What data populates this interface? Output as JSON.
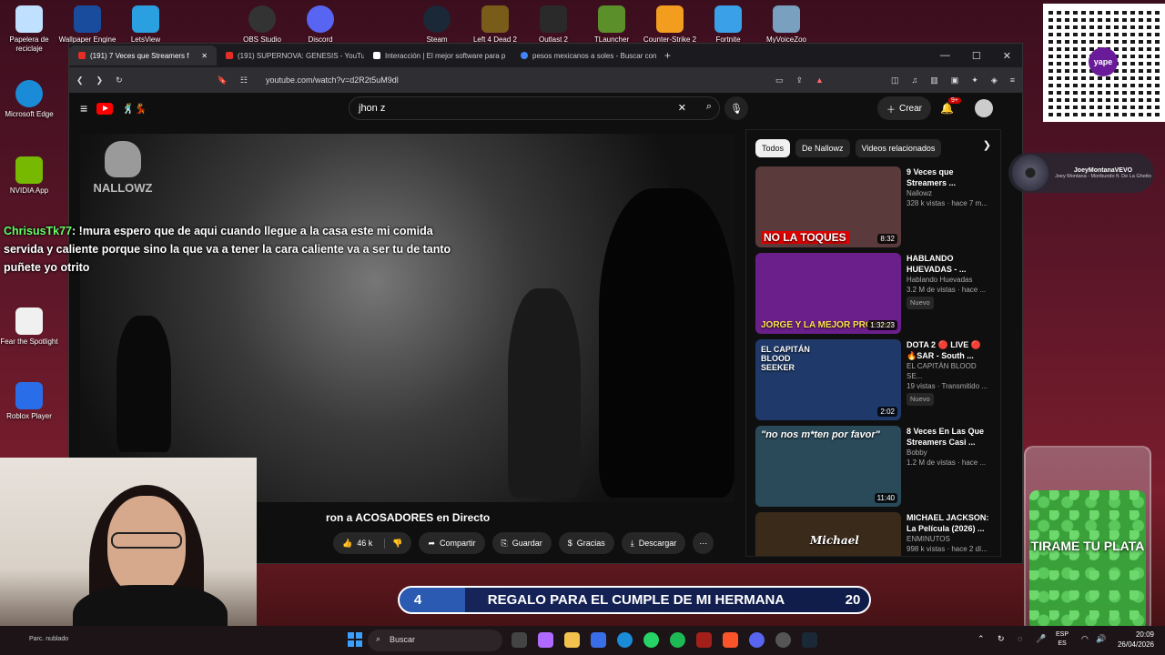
{
  "desktop_icons": [
    {
      "label": "Papelera de reciclaje",
      "color": "#bfe0ff"
    },
    {
      "label": "Wallpaper Engine",
      "color": "#1a4c9e"
    },
    {
      "label": "LetsView",
      "color": "#2aa0e0"
    },
    {
      "label": "OBS Studio",
      "color": "#333333"
    },
    {
      "label": "Discord",
      "color": "#5865f2"
    },
    {
      "label": "Steam",
      "color": "#1b2838"
    },
    {
      "label": "Left 4 Dead 2",
      "color": "#7a5c1a"
    },
    {
      "label": "Outlast 2",
      "color": "#2a2a2a"
    },
    {
      "label": "TLauncher",
      "color": "#5a8f2a"
    },
    {
      "label": "Counter-Strike 2",
      "color": "#f29d1e"
    },
    {
      "label": "Fortnite",
      "color": "#3aa0e8"
    },
    {
      "label": "MyVoiceZoo",
      "color": "#7aa0c0"
    },
    {
      "label": "Microsoft Edge",
      "color": "#1a8bd6"
    },
    {
      "label": "NVIDIA App",
      "color": "#76b900"
    },
    {
      "label": "Fear the Spotlight",
      "color": "#f0f0f0"
    },
    {
      "label": "Roblox Player",
      "color": "#2a6de8"
    }
  ],
  "qr": {
    "brand": "yape"
  },
  "browser": {
    "tabs": [
      {
        "title": "(191) 7 Veces que Streamers f",
        "active": true
      },
      {
        "title": "(191) SUPERNOVA: GENESIS - YouTub",
        "active": false
      },
      {
        "title": "Interacción | El mejor software para p",
        "active": false
      },
      {
        "title": "pesos mexicanos a soles - Buscar con",
        "active": false
      }
    ],
    "url": "youtube.com/watch?v=d2R2t5uM9dl"
  },
  "youtube": {
    "search_value": "jhon z",
    "create_label": "Crear",
    "notif_count": "9+",
    "watermark": "NALLOWZ",
    "video_title": "ron a ACOSADORES en Directo",
    "actions": {
      "likes": "46 k",
      "share": "Compartir",
      "save": "Guardar",
      "thanks": "Gracias",
      "download": "Descargar"
    },
    "chips": [
      "Todos",
      "De Nallowz",
      "Videos relacionados"
    ],
    "recommendations": [
      {
        "title": "9 Veces que Streamers ...",
        "channel": "Nallowz",
        "meta": "328 k vistas · hace 7 m...",
        "duration": "8:32",
        "caption": "NO LA TOQUES",
        "badge": "",
        "color": "#3a2a2a"
      },
      {
        "title": "HABLANDO HUEVADAS - ...",
        "channel": "Hablando Huevadas",
        "meta": "3.2 M de vistas · hace ...",
        "duration": "1:32:23",
        "caption": "JORGE Y LA MEJOR PROPINA",
        "badge": "Nuevo",
        "color": "#6a1f8a"
      },
      {
        "title": "DOTA 2 🔴 LIVE 🔴 🔥SAR - South ...",
        "channel": "EL CAPITÁN BLOOD SE...",
        "meta": "19 vistas · Transmitido ...",
        "duration": "2:02",
        "caption": "EL CAPITÁN BLOOD SEEKER",
        "badge": "Nuevo",
        "color": "#1f3a6a"
      },
      {
        "title": "8 Veces En Las Que Streamers Casi ...",
        "channel": "Bobby",
        "meta": "1.2 M de vistas · hace ...",
        "duration": "11:40",
        "caption": "\"no nos m*ten por favor\"",
        "badge": "",
        "color": "#2a4a5a"
      },
      {
        "title": "MICHAEL JACKSON: La Película (2026) ...",
        "channel": "ENMINUTOS",
        "meta": "998 k vistas · hace 2 dí...",
        "duration": "",
        "caption": "Michael",
        "badge": "",
        "color": "#3a2a1a"
      }
    ]
  },
  "chat": {
    "user": "ChrisusTk77",
    "message": ": !mura espero que de aqui cuando llegue a la casa este mi comida servida y caliente porque sino la que va a tener la cara caliente va a ser tu de tanto puñete yo otrito"
  },
  "now_playing": {
    "artist": "JoeyMontanaVEVO",
    "song": "Joey Montana - Moribundo ft. De La Ghetto"
  },
  "goal": {
    "current": "4",
    "label": "REGALO PARA EL CUMPLE DE MI HERMANA",
    "target": "20"
  },
  "jar_text": "TIRAME TU PLATA",
  "taskbar": {
    "weather": "Parc. nublado",
    "search_placeholder": "Buscar",
    "lang_top": "ESP",
    "lang_bottom": "ES",
    "time": "20:09",
    "date": "26/04/2026"
  }
}
